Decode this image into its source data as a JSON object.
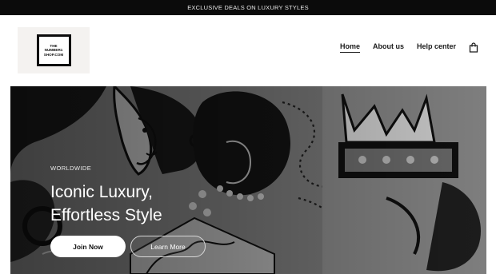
{
  "announcement": {
    "text": "EXCLUSIVE DEALS ON LUXURY STYLES"
  },
  "logo": {
    "line1": "THE",
    "line2": "NUMBER1",
    "line3": "SHOP.COM"
  },
  "nav": {
    "items": [
      {
        "label": "Home",
        "active": true
      },
      {
        "label": "About us",
        "active": false
      },
      {
        "label": "Help center",
        "active": false
      }
    ],
    "cart_icon": "shopping-bag-icon"
  },
  "hero": {
    "eyebrow": "WORLDWIDE",
    "headline_line1": "Iconic Luxury,",
    "headline_line2": "Effortless Style",
    "primary_button": "Join Now",
    "secondary_button": "Learn More",
    "background_image": "black-and-white-graffiti-mural"
  },
  "colors": {
    "announcement_bg": "#0b0b0b",
    "logo_bg": "#f4f2f0",
    "text": "#1a1a1a",
    "hero_text": "#ffffff"
  }
}
